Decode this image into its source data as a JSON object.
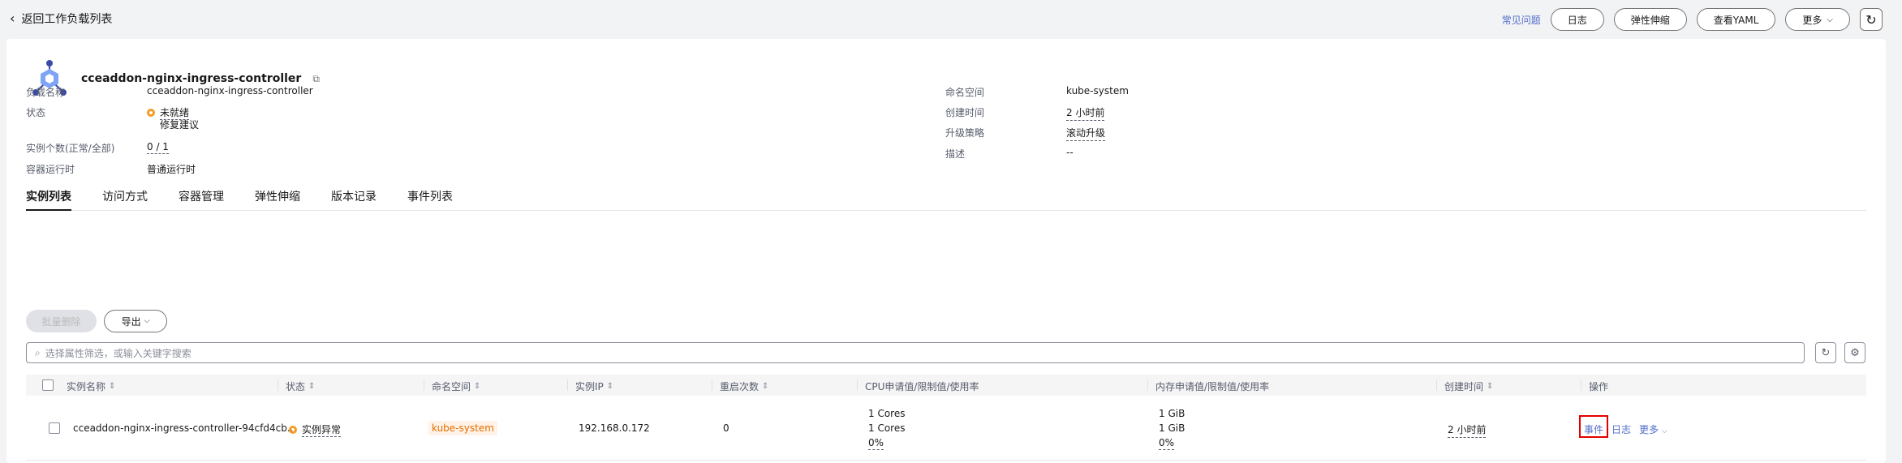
{
  "topbar": {
    "back_label": "返回工作负载列表",
    "faq_link": "常见问题",
    "buttons": {
      "log": "日志",
      "scaling": "弹性伸缩",
      "yaml": "查看YAML",
      "more": "更多"
    }
  },
  "workload": {
    "name": "cceaddon-nginx-ingress-controller"
  },
  "info": {
    "left": {
      "name_label": "负载名称",
      "name_value": "cceaddon-nginx-ingress-controller",
      "status_label": "状态",
      "status_value": "未就绪",
      "repair_link": "修复建议",
      "instances_label": "实例个数(正常/全部)",
      "instances_value": "0 / 1",
      "runtime_label": "容器运行时",
      "runtime_value": "普通运行时"
    },
    "right": {
      "namespace_label": "命名空间",
      "namespace_value": "kube-system",
      "created_label": "创建时间",
      "created_value": "2 小时前",
      "upgrade_label": "升级策略",
      "upgrade_value": "滚动升级",
      "desc_label": "描述",
      "desc_value": "--"
    }
  },
  "tabs": [
    "实例列表",
    "访问方式",
    "容器管理",
    "弹性伸缩",
    "版本记录",
    "事件列表"
  ],
  "toolbar": {
    "batch_delete": "批量删除",
    "export": "导出"
  },
  "search": {
    "placeholder": "选择属性筛选，或输入关键字搜索"
  },
  "table": {
    "headers": {
      "name": "实例名称",
      "status": "状态",
      "namespace": "命名空间",
      "ip": "实例IP",
      "restarts": "重启次数",
      "cpu": "CPU申请值/限制值/使用率",
      "mem": "内存申请值/限制值/使用率",
      "created": "创建时间",
      "ops": "操作"
    },
    "rows": [
      {
        "name": "cceaddon-nginx-ingress-controller-94cfd4cb...",
        "status": "实例异常",
        "namespace": "kube-system",
        "ip": "192.168.0.172",
        "restarts": "0",
        "cpu_request": "1 Cores",
        "cpu_limit": "1 Cores",
        "cpu_usage": "0%",
        "mem_request": "1 GiB",
        "mem_limit": "1 GiB",
        "mem_usage": "0%",
        "created": "2 小时前",
        "op_events": "事件",
        "op_log": "日志",
        "op_more": "更多"
      }
    ]
  },
  "colors": {
    "accent_blue": "#526ecc",
    "warning_orange": "#f59b22",
    "highlight_red": "#e50000"
  }
}
